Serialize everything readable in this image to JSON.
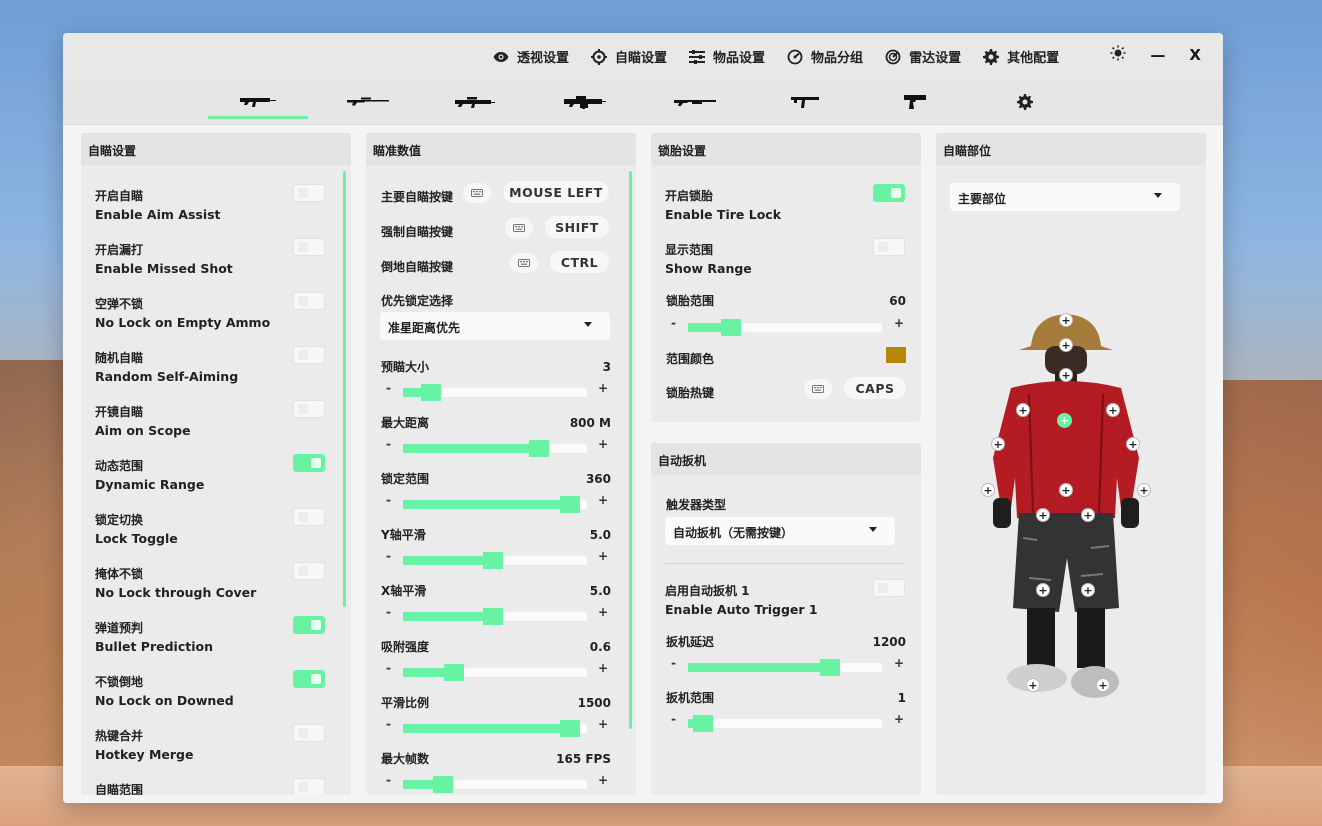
{
  "nav": [
    {
      "icon": "eye-icon",
      "label": "透视设置"
    },
    {
      "icon": "crosshair-icon",
      "label": "自瞄设置"
    },
    {
      "icon": "sliders-icon",
      "label": "物品设置"
    },
    {
      "icon": "gauge-icon",
      "label": "物品分组"
    },
    {
      "icon": "radar-icon",
      "label": "雷达设置"
    },
    {
      "icon": "gear-icon",
      "label": "其他配置"
    }
  ],
  "window_controls": {
    "theme_icon": "sun-icon",
    "minimize": "—",
    "close": "X"
  },
  "weapons": [
    "assault-rifle-icon",
    "sniper-rifle-icon",
    "marksman-rifle-icon",
    "lmg-icon",
    "shotgun-icon",
    "smg-icon",
    "pistol-icon",
    "settings-gear-icon"
  ],
  "aim_panel": {
    "title": "自瞄设置",
    "items": [
      {
        "cn": "开启自瞄",
        "en": "Enable Aim Assist",
        "on": false
      },
      {
        "cn": "开启漏打",
        "en": "Enable Missed Shot",
        "on": false
      },
      {
        "cn": "空弹不锁",
        "en": "No Lock on Empty Ammo",
        "on": false
      },
      {
        "cn": "随机自瞄",
        "en": "Random Self-Aiming",
        "on": false
      },
      {
        "cn": "开镜自瞄",
        "en": "Aim on Scope",
        "on": false
      },
      {
        "cn": "动态范围",
        "en": "Dynamic Range",
        "on": true
      },
      {
        "cn": "锁定切换",
        "en": "Lock Toggle",
        "on": false
      },
      {
        "cn": "掩体不锁",
        "en": "No Lock through Cover",
        "on": false
      },
      {
        "cn": "弹道预判",
        "en": "Bullet Prediction",
        "on": true
      },
      {
        "cn": "不锁倒地",
        "en": "No Lock on Downed",
        "on": true
      },
      {
        "cn": "热键合并",
        "en": "Hotkey Merge",
        "on": false
      },
      {
        "cn": "自瞄范围",
        "en": "",
        "on": false
      }
    ]
  },
  "aimval_panel": {
    "title": "瞄准数值",
    "keys": [
      {
        "label": "主要自瞄按键",
        "key": "MOUSE LEFT"
      },
      {
        "label": "强制自瞄按键",
        "key": "SHIFT"
      },
      {
        "label": "倒地自瞄按键",
        "key": "CTRL"
      }
    ],
    "priority_label": "优先锁定选择",
    "priority_value": "准星距离优先",
    "sliders": [
      {
        "label": "预瞄大小",
        "value": "3",
        "fraction": 0.11
      },
      {
        "label": "最大距离",
        "value": "800 M",
        "fraction": 0.77
      },
      {
        "label": "锁定范围",
        "value": "360",
        "fraction": 0.96
      },
      {
        "label": "Y轴平滑",
        "value": "5.0",
        "fraction": 0.49
      },
      {
        "label": "X轴平滑",
        "value": "5.0",
        "fraction": 0.49
      },
      {
        "label": "吸附强度",
        "value": "0.6",
        "fraction": 0.25
      },
      {
        "label": "平滑比例",
        "value": "1500",
        "fraction": 0.96
      },
      {
        "label": "最大帧数",
        "value": "165 FPS",
        "fraction": 0.18
      }
    ]
  },
  "tire_panel": {
    "title": "锁胎设置",
    "toggles": [
      {
        "cn": "开启锁胎",
        "en": "Enable Tire Lock",
        "on": true
      },
      {
        "cn": "显示范围",
        "en": "Show Range",
        "on": false
      }
    ],
    "range_label": "锁胎范围",
    "range_value": "60",
    "range_fraction": 0.19,
    "color_label": "范围颜色",
    "color": "#b8860b",
    "hotkey_label": "锁胎热键",
    "hotkey": "CAPS"
  },
  "trigger_panel": {
    "title": "自动扳机",
    "type_label": "触发器类型",
    "type_value": "自动扳机（无需按键）",
    "toggle": {
      "cn": "启用自动扳机 1",
      "en": "Enable Auto Trigger 1",
      "on": false
    },
    "sliders": [
      {
        "label": "扳机延迟",
        "value": "1200",
        "fraction": 0.76
      },
      {
        "label": "扳机范围",
        "value": "1",
        "fraction": 0.03
      }
    ]
  },
  "body_panel": {
    "title": "自瞄部位",
    "select_value": "主要部位",
    "hitpoints": [
      "+",
      "+",
      "+",
      "+",
      "+",
      "+",
      "+",
      "+",
      "+",
      "+",
      "+",
      "+",
      "+",
      "+",
      "+",
      "+",
      "+",
      "+",
      "+"
    ]
  },
  "colors": {
    "accent": "#67f2a4"
  }
}
